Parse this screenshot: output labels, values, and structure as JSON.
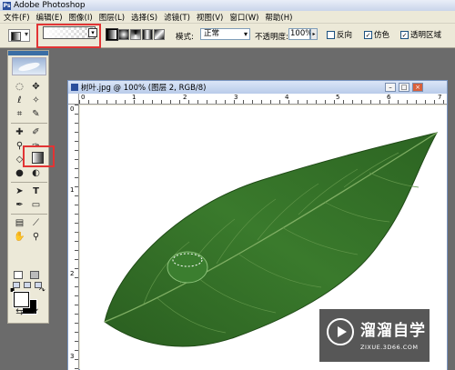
{
  "app": {
    "title": "Adobe Photoshop"
  },
  "menu": [
    "文件(F)",
    "编辑(E)",
    "图像(I)",
    "图层(L)",
    "选择(S)",
    "滤镜(T)",
    "视图(V)",
    "窗口(W)",
    "帮助(H)"
  ],
  "options": {
    "mode_label": "模式:",
    "mode_value": "正常",
    "opacity_label": "不透明度:",
    "opacity_value": "100%",
    "reverse_label": "反向",
    "dither_label": "仿色",
    "transparency_label": "透明区域",
    "reverse_checked": false,
    "dither_checked": true,
    "transparency_checked": true
  },
  "document": {
    "title": "树叶.jpg @ 100% (图层 2, RGB/8)",
    "ruler_h": [
      "0",
      "1",
      "2",
      "3",
      "4",
      "5",
      "6",
      "7"
    ],
    "ruler_v": [
      "0",
      "1",
      "2",
      "3"
    ]
  },
  "watermark": {
    "name": "溜溜自学",
    "url": "ZIXUE.3D66.COM"
  },
  "colors": {
    "highlight": "#e23434",
    "leaf": "#2f6a25"
  }
}
